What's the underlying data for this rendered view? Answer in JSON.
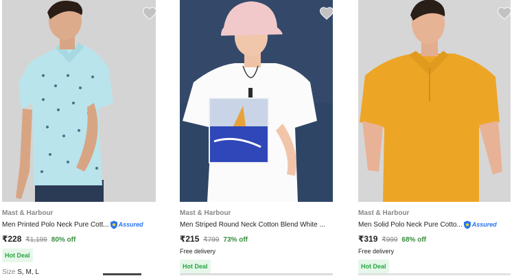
{
  "products": [
    {
      "brand": "Mast & Harbour",
      "title": "Men Printed Polo Neck Pure Cott...",
      "assured": true,
      "assured_label": "Assured",
      "price": "₹228",
      "mrp": "₹1,199",
      "discount": "80% off",
      "free_delivery": "",
      "deal": "Hot Deal",
      "size_label": "Size",
      "sizes": "S, M, L",
      "image": "man-in-light-blue-printed-polo-shirt"
    },
    {
      "brand": "Mast & Harbour",
      "title": "Men Striped Round Neck Cotton Blend White ...",
      "assured": false,
      "price": "₹215",
      "mrp": "₹799",
      "discount": "73% off",
      "free_delivery": "Free delivery",
      "deal": "Hot Deal",
      "image": "man-in-white-graphic-tshirt-and-pink-bucket-hat"
    },
    {
      "brand": "Mast & Harbour",
      "title": "Men Solid Polo Neck Pure Cotto...",
      "assured": true,
      "assured_label": "Assured",
      "price": "₹319",
      "mrp": "₹999",
      "discount": "68% off",
      "free_delivery": "Free delivery",
      "deal": "Hot Deal",
      "image": "man-in-mustard-yellow-polo-shirt"
    }
  ],
  "colors": {
    "discount": "#388e3c",
    "deal_bg": "#e6f7ea",
    "deal_text": "#26a541",
    "assured_blue": "#2874f0",
    "wishlist_heart": "#c2c2c2"
  },
  "icons": [
    "heart-icon",
    "assured-badge-icon"
  ]
}
